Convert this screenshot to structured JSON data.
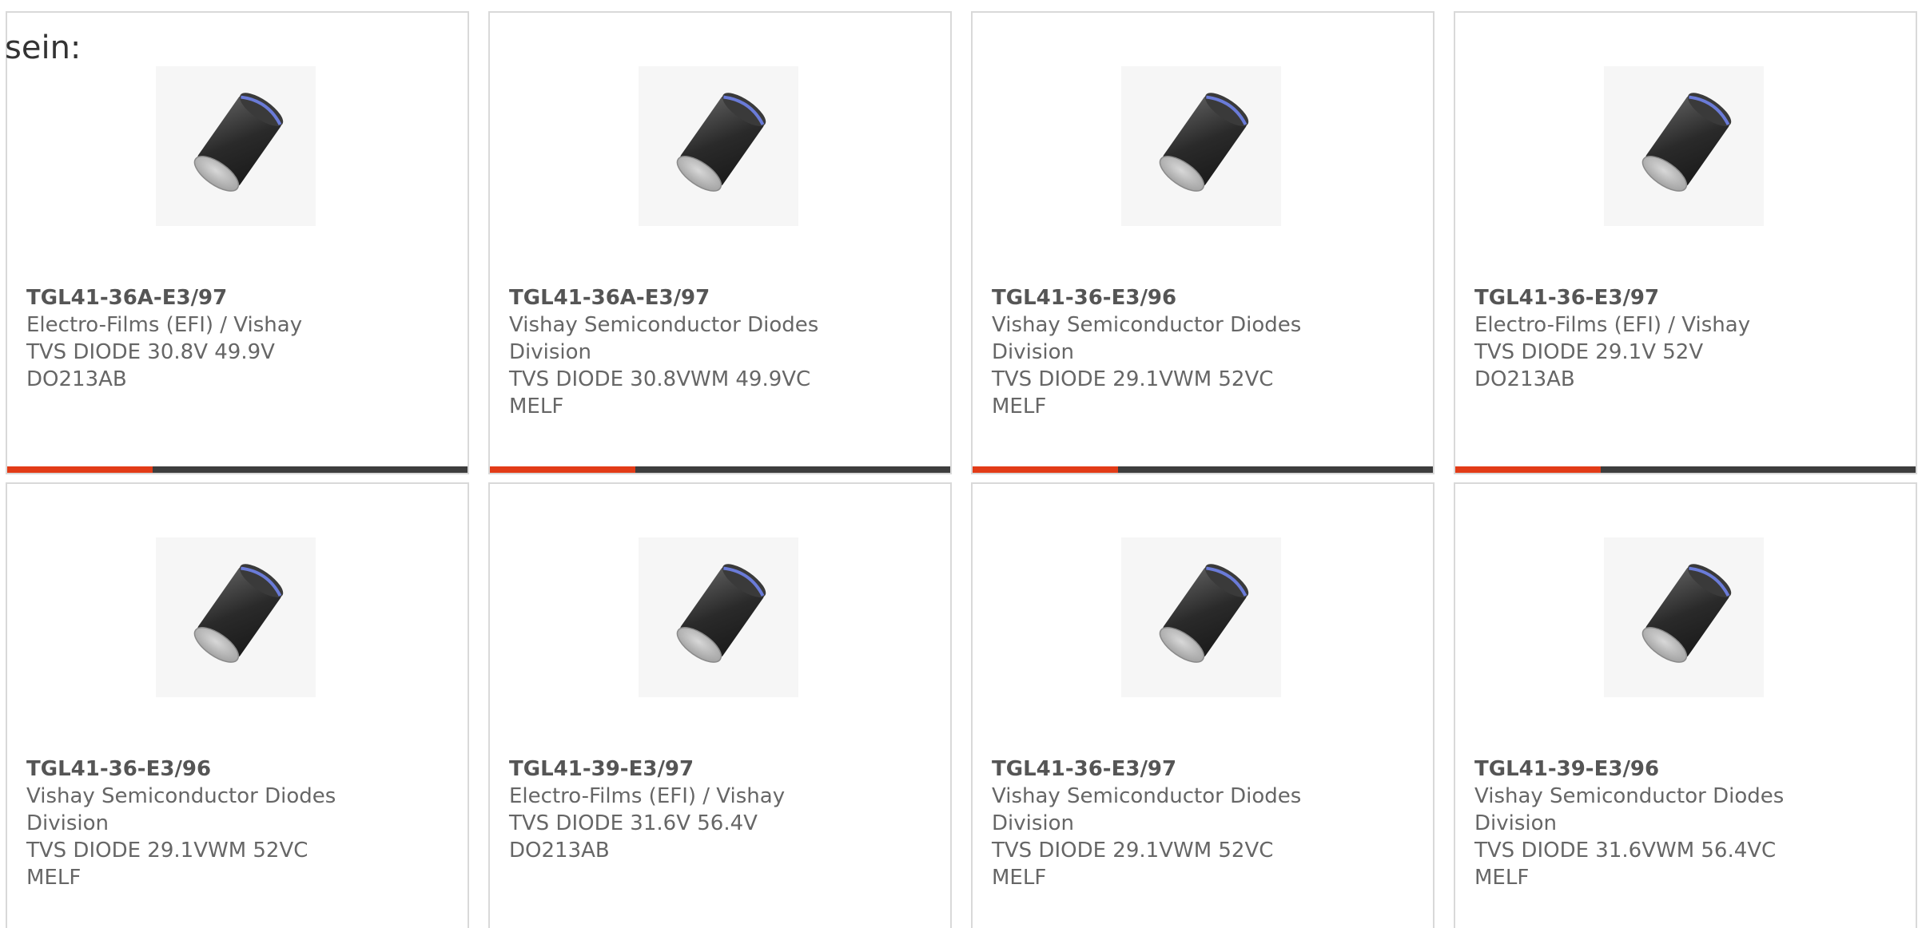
{
  "intro_text": "sein:",
  "colors": {
    "accent": "#e23b17",
    "bar_dark": "#3d3d3d",
    "card_border": "#d9d9d9",
    "text": "#666666"
  },
  "products": [
    {
      "part_number": "TGL41-36A-E3/97",
      "lines": [
        "Electro-Films (EFI) / Vishay",
        "TVS DIODE 30.8V 49.9V",
        "DO213AB"
      ],
      "image_icon": "melf-diode-image"
    },
    {
      "part_number": "TGL41-36A-E3/97",
      "lines": [
        "Vishay Semiconductor Diodes",
        "Division",
        "TVS DIODE 30.8VWM 49.9VC",
        "MELF"
      ],
      "image_icon": "melf-diode-image"
    },
    {
      "part_number": "TGL41-36-E3/96",
      "lines": [
        "Vishay Semiconductor Diodes",
        "Division",
        "TVS DIODE 29.1VWM 52VC MELF"
      ],
      "image_icon": "melf-diode-image"
    },
    {
      "part_number": "TGL41-36-E3/97",
      "lines": [
        "Electro-Films (EFI) / Vishay",
        "TVS DIODE 29.1V 52V DO213AB"
      ],
      "image_icon": "melf-diode-image"
    },
    {
      "part_number": "TGL41-36-E3/96",
      "lines": [
        "Vishay Semiconductor Diodes",
        "Division",
        "TVS DIODE 29.1VWM 52VC MELF"
      ],
      "image_icon": "melf-diode-image"
    },
    {
      "part_number": "TGL41-39-E3/97",
      "lines": [
        "Electro-Films (EFI) / Vishay",
        "TVS DIODE 31.6V 56.4V",
        "DO213AB"
      ],
      "image_icon": "melf-diode-image"
    },
    {
      "part_number": "TGL41-36-E3/97",
      "lines": [
        "Vishay Semiconductor Diodes",
        "Division",
        "TVS DIODE 29.1VWM 52VC MELF"
      ],
      "image_icon": "melf-diode-image"
    },
    {
      "part_number": "TGL41-39-E3/96",
      "lines": [
        "Vishay Semiconductor Diodes",
        "Division",
        "TVS DIODE 31.6VWM 56.4VC",
        "MELF"
      ],
      "image_icon": "melf-diode-image"
    }
  ]
}
